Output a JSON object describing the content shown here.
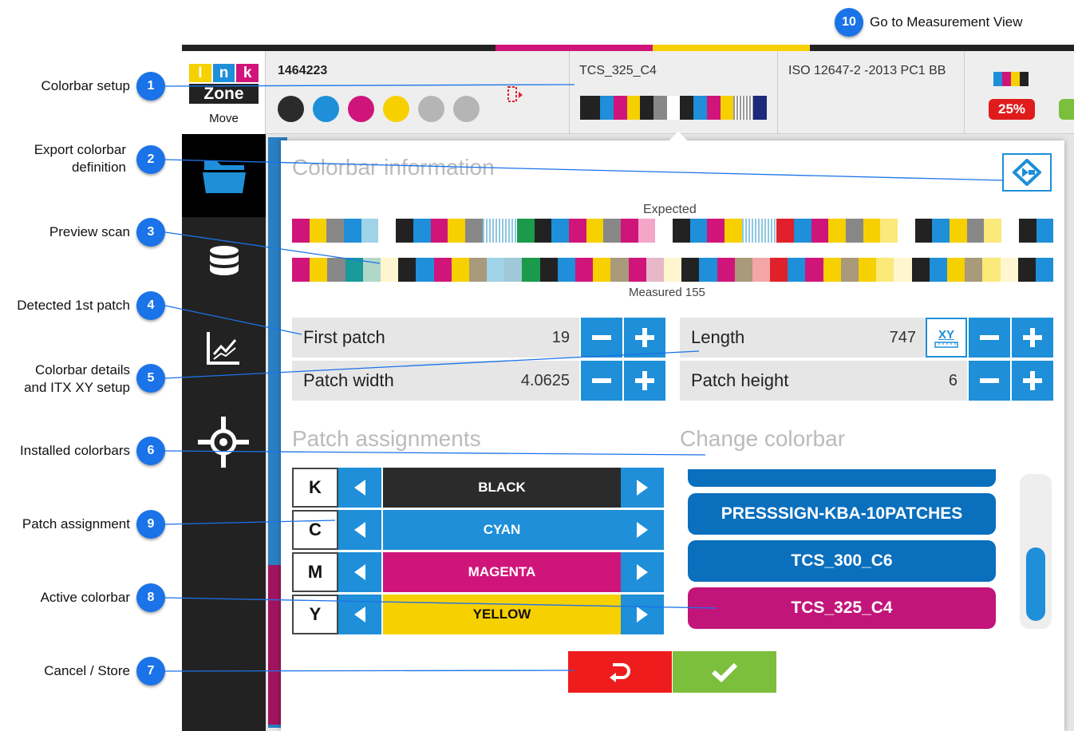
{
  "callouts": [
    {
      "num": "1",
      "label": "Colorbar setup"
    },
    {
      "num": "2",
      "label": "Export colorbar\ndefinition"
    },
    {
      "num": "3",
      "label": "Preview scan"
    },
    {
      "num": "4",
      "label": "Detected 1st patch"
    },
    {
      "num": "5",
      "label": "Colorbar details\nand ITX XY setup"
    },
    {
      "num": "6",
      "label": "Installed colorbars"
    },
    {
      "num": "9",
      "label": "Patch assignment"
    },
    {
      "num": "8",
      "label": "Active colorbar"
    },
    {
      "num": "7",
      "label": "Cancel / Store"
    },
    {
      "num": "10",
      "label": "Go to Measurement View"
    }
  ],
  "logo": {
    "line1": [
      "I",
      "n",
      "k"
    ],
    "line2": "Zone",
    "caption": "Move"
  },
  "header": {
    "job_id": "1464223",
    "colorbar_name": "TCS_325_C4",
    "standard": "ISO 12647-2 -2013 PC1 BB",
    "percent_badge": "25%"
  },
  "ink_dots": [
    "#2b2b2b",
    "#1e8fd8",
    "#d0157a",
    "#f7d000",
    "#b5b5b5",
    "#b5b5b5"
  ],
  "panel": {
    "title": "Colorbar information",
    "expected_label": "Expected",
    "measured_label": "Measured 155",
    "first_patch_label": "First patch",
    "first_patch_value": "19",
    "patch_width_label": "Patch width",
    "patch_width_value": "4.0625",
    "length_label": "Length",
    "length_value": "747",
    "xy_label": "XY",
    "patch_height_label": "Patch height",
    "patch_height_value": "6",
    "patch_assignments_title": "Patch assignments",
    "change_colorbar_title": "Change colorbar"
  },
  "assignments": [
    {
      "key": "K",
      "name": "BLACK",
      "color": "#2b2b2b"
    },
    {
      "key": "C",
      "name": "CYAN",
      "color": "#1e8fd8"
    },
    {
      "key": "M",
      "name": "MAGENTA",
      "color": "#d0157a"
    },
    {
      "key": "Y",
      "name": "YELLOW",
      "color": "#f7d000"
    }
  ],
  "colorbars": [
    {
      "name": "PRESSSIGN-KBA-10PATCHES",
      "active": false
    },
    {
      "name": "TCS_300_C6",
      "active": false
    },
    {
      "name": "TCS_325_C4",
      "active": true
    }
  ],
  "colors": {
    "blue": "#1e8fd8",
    "active_colorbar": "#c2157a",
    "inactive_colorbar": "#0a6fbd",
    "cancel": "#ee1c1c",
    "store": "#7cbf3c",
    "badge": "#1a73e8"
  },
  "icons": [
    "folder-icon",
    "database-icon",
    "chart-icon",
    "target-icon",
    "export-icon",
    "minus-icon",
    "plus-icon",
    "arrow-left-icon",
    "arrow-right-icon",
    "undo-icon",
    "check-icon"
  ]
}
